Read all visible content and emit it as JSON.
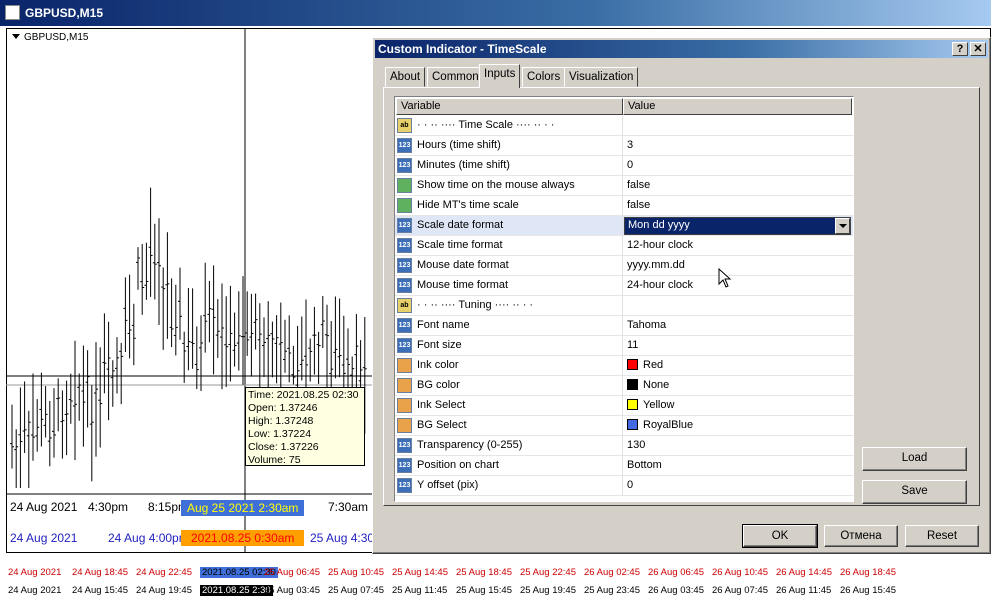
{
  "chart": {
    "window_title": "GBPUSD,M15",
    "inner_label": "GBPUSD,M15",
    "tooltip": [
      "Time: 2021.08.25 02:30",
      "Open: 1.37246",
      "High: 1.37248",
      "Low: 1.37224",
      "Close: 1.37226",
      "Volume: 75"
    ],
    "axis1": [
      "24 Aug 2021",
      "4:30pm",
      "8:15pm",
      "Aug 25 2021 2:30am",
      "7:30am"
    ],
    "axis2": [
      "24 Aug 2021",
      "24 Aug 4:00pm",
      "2021.08.25 0:30am",
      "25 Aug 4:30"
    ],
    "axis3": [
      "24 Aug 2021",
      "24 Aug 18:45",
      "24 Aug 22:45",
      "2021.08.25 02:30",
      "25 Aug 06:45",
      "25 Aug 10:45",
      "25 Aug 14:45",
      "25 Aug 18:45",
      "25 Aug 22:45",
      "26 Aug 02:45",
      "26 Aug 06:45",
      "26 Aug 10:45",
      "26 Aug 14:45",
      "26 Aug 18:45"
    ],
    "axis4": [
      "24 Aug 2021",
      "24 Aug 15:45",
      "24 Aug 19:45",
      "2021.08.25 2:30",
      "25 Aug 03:45",
      "25 Aug 07:45",
      "25 Aug 11:45",
      "25 Aug 15:45",
      "25 Aug 19:45",
      "25 Aug 23:45",
      "26 Aug 03:45",
      "26 Aug 07:45",
      "26 Aug 11:45",
      "26 Aug 15:45"
    ]
  },
  "dialog": {
    "title": "Custom Indicator - TimeScale",
    "help_button": "?",
    "close_button": "✕",
    "tabs": [
      "About",
      "Common",
      "Inputs",
      "Colors",
      "Visualization"
    ],
    "active_tab": "Inputs",
    "columns": [
      "Variable",
      "Value"
    ],
    "rows": [
      {
        "type": "str",
        "icon": "string-param-icon",
        "variable": "·  ·  ·· ···· Time Scale ···· ··  ·  ·",
        "value": ""
      },
      {
        "type": "num",
        "icon": "integer-param-icon",
        "variable": "Hours (time shift)",
        "value": "3"
      },
      {
        "type": "num",
        "icon": "integer-param-icon",
        "variable": "Minutes (time shift)",
        "value": "0"
      },
      {
        "type": "bool",
        "icon": "boolean-param-icon",
        "variable": "Show time on the mouse always",
        "value": "false"
      },
      {
        "type": "bool",
        "icon": "boolean-param-icon",
        "variable": "Hide MT's time scale",
        "value": "false"
      },
      {
        "type": "num",
        "icon": "integer-param-icon",
        "variable": "Scale date format",
        "value": "Mon dd yyyy",
        "editing": true
      },
      {
        "type": "num",
        "icon": "integer-param-icon",
        "variable": "Scale time format",
        "value": "12-hour clock"
      },
      {
        "type": "num",
        "icon": "integer-param-icon",
        "variable": "Mouse date format",
        "value": "yyyy.mm.dd"
      },
      {
        "type": "num",
        "icon": "integer-param-icon",
        "variable": "Mouse time format",
        "value": "24-hour clock"
      },
      {
        "type": "str",
        "icon": "string-param-icon",
        "variable": "·  ·  ·· ···· Tuning ···· ··  ·  ·",
        "value": ""
      },
      {
        "type": "num",
        "icon": "integer-param-icon",
        "variable": "Font name",
        "value": "Tahoma"
      },
      {
        "type": "num",
        "icon": "integer-param-icon",
        "variable": "Font size",
        "value": "11"
      },
      {
        "type": "col",
        "icon": "color-param-icon",
        "variable": "Ink color",
        "value": "Red",
        "swatch": "#ff0000"
      },
      {
        "type": "col",
        "icon": "color-param-icon",
        "variable": "BG color",
        "value": "None",
        "swatch": "#000000"
      },
      {
        "type": "col",
        "icon": "color-param-icon",
        "variable": "Ink Select",
        "value": "Yellow",
        "swatch": "#ffff00"
      },
      {
        "type": "col",
        "icon": "color-param-icon",
        "variable": "BG Select",
        "value": "RoyalBlue",
        "swatch": "#4169e1"
      },
      {
        "type": "num",
        "icon": "integer-param-icon",
        "variable": "Transparency (0-255)",
        "value": "130"
      },
      {
        "type": "num",
        "icon": "integer-param-icon",
        "variable": "Position on chart",
        "value": "Bottom"
      },
      {
        "type": "num",
        "icon": "integer-param-icon",
        "variable": "Y offset (pix)",
        "value": "0"
      }
    ],
    "buttons": {
      "load": "Load",
      "save": "Save",
      "ok": "OK",
      "cancel": "Отмена",
      "reset": "Reset"
    }
  }
}
